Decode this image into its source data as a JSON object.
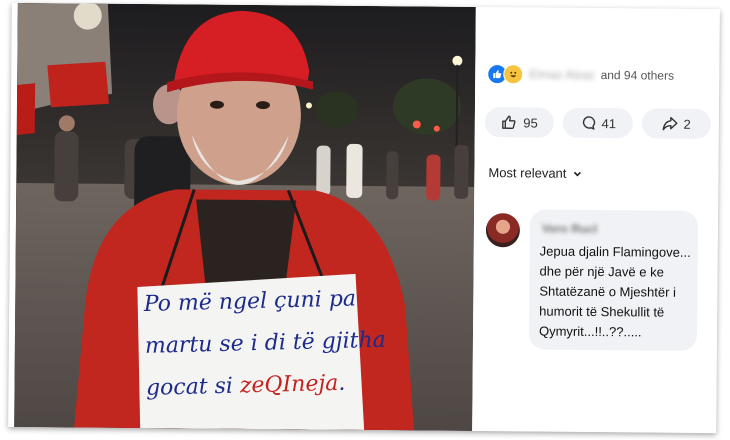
{
  "photo": {
    "sign_lines": [
      "Po më ngel çuni pa",
      "martu se i di të gjitha",
      "gocat si "
    ],
    "sign_red": "zeQIneja",
    "sign_end": "."
  },
  "reactions": {
    "names": "Elmaz Alzaz",
    "others": "and 94 others"
  },
  "actions": {
    "likes": "95",
    "comments": "41",
    "shares": "2"
  },
  "sort": {
    "label": "Most relevant"
  },
  "comment": {
    "author": "Vero Rucl",
    "text": "Jepua djalin Flamingove... dhe për një Javë e ke Shtatëzanë o Mjeshtër i humorit të Shekullit të Qymyrit...!!..??....."
  }
}
